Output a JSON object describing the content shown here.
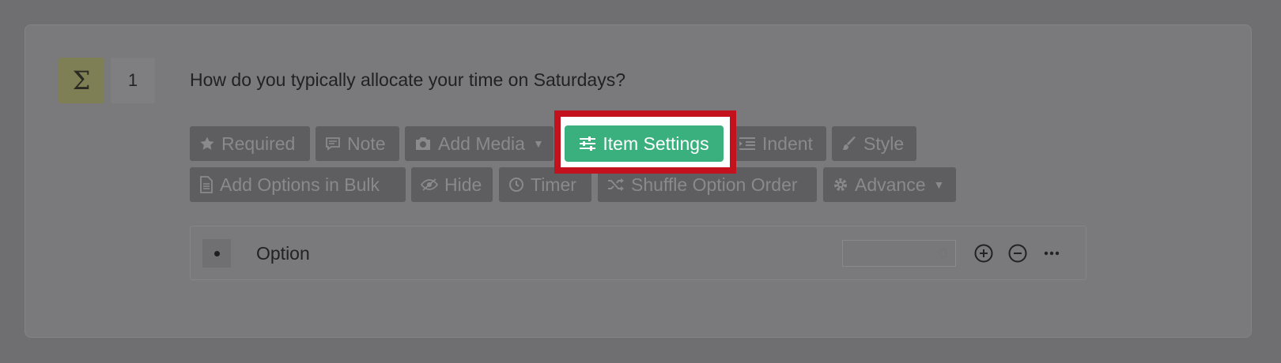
{
  "question": {
    "type_symbol": "Σ",
    "number": "1",
    "text": "How do you typically allocate your time on Saturdays?"
  },
  "toolbar": {
    "required": "Required",
    "note": "Note",
    "add_media": "Add Media",
    "item_settings": "Item Settings",
    "indent": "Indent",
    "style": "Style",
    "add_options_bulk": "Add Options in Bulk",
    "hide": "Hide",
    "timer": "Timer",
    "shuffle": "Shuffle Option Order",
    "advance": "Advance"
  },
  "option": {
    "label": "Option",
    "score_placeholder": "0"
  },
  "colors": {
    "overlay_bg": "#6f6e70",
    "highlight_border": "#c3121e",
    "item_settings_bg": "#3bb07f",
    "type_badge_bg": "#7f7f56"
  },
  "icons": {
    "required": "star-icon",
    "note": "comment-icon",
    "add_media": "camera-icon",
    "item_settings": "sliders-icon",
    "indent": "indent-icon",
    "style": "brush-icon",
    "add_options_bulk": "file-icon",
    "hide": "eye-slash-icon",
    "timer": "clock-icon",
    "shuffle": "shuffle-icon",
    "advance": "gear-icon",
    "add": "plus-circle-icon",
    "remove": "minus-circle-icon",
    "more": "more-icon"
  }
}
